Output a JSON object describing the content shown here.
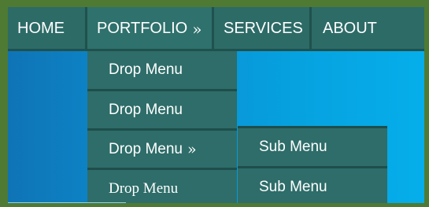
{
  "nav": {
    "items": [
      {
        "label": "HOME"
      },
      {
        "label": "PORTFOLIO",
        "arrow": "»"
      },
      {
        "label": "SERVICES"
      },
      {
        "label": "ABOUT"
      }
    ]
  },
  "dropdown": {
    "items": [
      {
        "label": "Drop Menu"
      },
      {
        "label": "Drop Menu"
      },
      {
        "label": "Drop Menu",
        "arrow": "»"
      },
      {
        "label": "Drop Menu"
      }
    ]
  },
  "submenu": {
    "items": [
      {
        "label": "Sub Menu"
      },
      {
        "label": "Sub Menu"
      }
    ]
  },
  "colors": {
    "background": "#4e7a33",
    "menu": "#2d6b67",
    "divider": "#1f514e",
    "gradient_start": "#0f74b6",
    "gradient_end": "#05aeea"
  }
}
